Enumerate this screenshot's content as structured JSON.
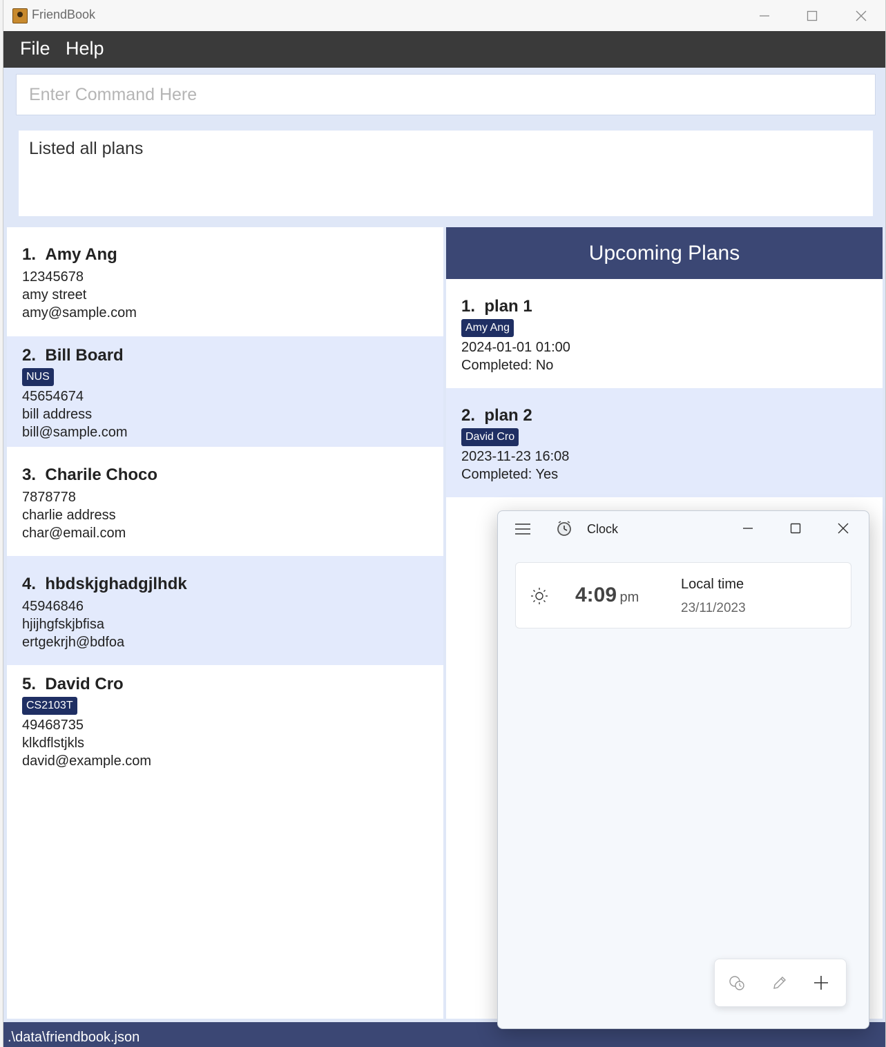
{
  "window": {
    "title": "FriendBook",
    "minimize": "–",
    "maximize": "☐",
    "close": "✕"
  },
  "menu": {
    "file": "File",
    "help": "Help"
  },
  "command": {
    "placeholder": "Enter Command Here",
    "value": ""
  },
  "result": {
    "text": "Listed all plans"
  },
  "persons": [
    {
      "index": "1.",
      "name": "Amy Ang",
      "tag": "",
      "phone": "12345678",
      "address": "amy street",
      "email": "amy@sample.com"
    },
    {
      "index": "2.",
      "name": "Bill Board",
      "tag": "NUS",
      "phone": "45654674",
      "address": "bill address",
      "email": "bill@sample.com"
    },
    {
      "index": "3.",
      "name": "Charile Choco",
      "tag": "",
      "phone": "7878778",
      "address": "charlie address",
      "email": "char@email.com"
    },
    {
      "index": "4.",
      "name": "hbdskjghadgjlhdk",
      "tag": "",
      "phone": "45946846",
      "address": "hjijhgfskjbfisa",
      "email": "ertgekrjh@bdfoa"
    },
    {
      "index": "5.",
      "name": "David Cro",
      "tag": "CS2103T",
      "phone": "49468735",
      "address": "klkdflstjkls",
      "email": "david@example.com"
    }
  ],
  "plans": {
    "header": "Upcoming Plans",
    "items": [
      {
        "index": "1.",
        "name": "plan 1",
        "friend": "Amy Ang",
        "datetime": "2024-01-01 01:00",
        "completed": "Completed: No"
      },
      {
        "index": "2.",
        "name": "plan 2",
        "friend": "David Cro",
        "datetime": "2023-11-23 16:08",
        "completed": "Completed: Yes"
      }
    ]
  },
  "status": {
    "path": ".\\data\\friendbook.json"
  },
  "clock": {
    "title": "Clock",
    "time": "4:09",
    "ampm": "pm",
    "label": "Local time",
    "date": "23/11/2023"
  },
  "colors": {
    "menubar": "#3a3a3a",
    "accent": "#3b4774",
    "tag": "#1f2f63",
    "alt_row": "#e3eafc"
  }
}
